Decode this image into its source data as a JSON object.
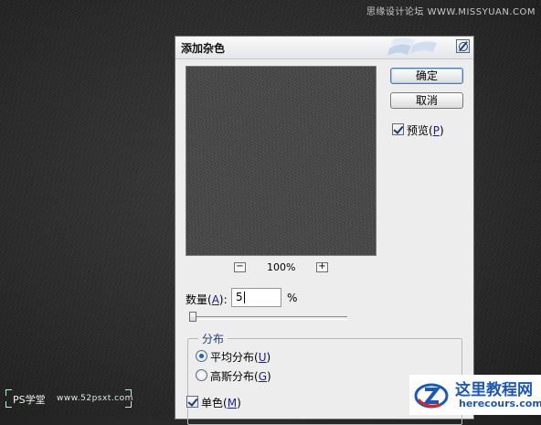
{
  "watermark_top": "思缘设计论坛 WWW.MISSYUAN.COM",
  "ps_logo": {
    "text": "PS学堂",
    "url": "www.52psxt.com"
  },
  "dialog": {
    "title": "添加杂色",
    "ok_label": "确定",
    "cancel_label": "取消",
    "preview_label": "预览",
    "preview_key": "P",
    "preview_checked": true,
    "zoom_out_label": "−",
    "zoom_in_label": "+",
    "zoom_level": "100%",
    "amount_label": "数量",
    "amount_key": "A",
    "amount_value": "5",
    "amount_unit": "%",
    "distribution": {
      "title": "分布",
      "options": [
        {
          "label": "平均分布",
          "key": "U",
          "selected": true
        },
        {
          "label": "高斯分布",
          "key": "G",
          "selected": false
        }
      ]
    },
    "monochrome_label": "单色",
    "monochrome_key": "M",
    "monochrome_checked": true
  },
  "site_mark": {
    "name": "这里教程网",
    "url": "herecours.com"
  },
  "colors": {
    "background": "#2a2a2a",
    "dialog_bg": "#ededed",
    "accent": "#1c58b4"
  }
}
